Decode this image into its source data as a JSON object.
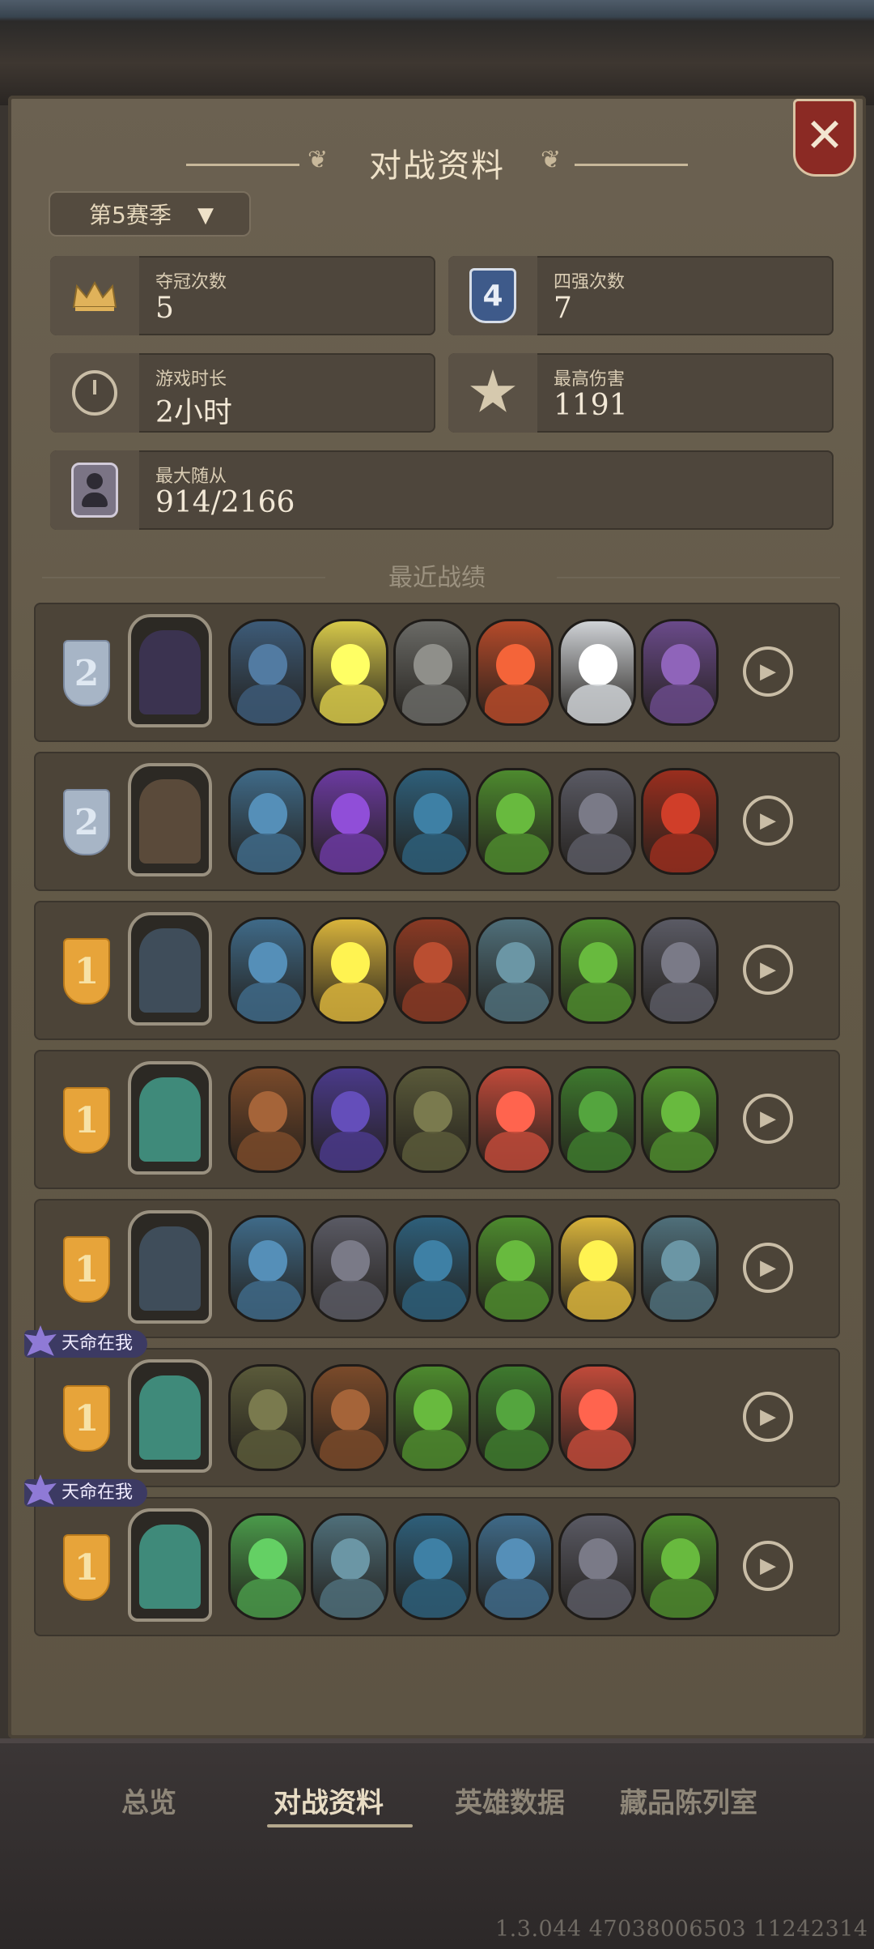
{
  "header": {
    "title": "对战资料",
    "close_label": "✕"
  },
  "season": {
    "label": "第5赛季"
  },
  "stats": {
    "champion": {
      "label": "夺冠次数",
      "value": "5"
    },
    "top4": {
      "label": "四强次数",
      "value": "7",
      "icon_text": "4"
    },
    "playtime": {
      "label": "游戏时长",
      "value": "2小时"
    },
    "max_damage": {
      "label": "最高伤害",
      "value": "1191"
    },
    "max_minion": {
      "label": "最大随从",
      "value": "914/2166"
    }
  },
  "recent": {
    "title": "最近战绩",
    "matches": [
      {
        "rank": "2",
        "rank_color": "silver",
        "tag": "",
        "hero_color": "#3b3350",
        "minions": [
          "#3d5b78",
          "#d7c94a",
          "#6a6a66",
          "#b54a2a",
          "#cfd2d6",
          "#6a4a8a"
        ]
      },
      {
        "rank": "2",
        "rank_color": "silver",
        "tag": "",
        "hero_color": "#5a4a3a",
        "minions": [
          "#3f6a88",
          "#6b3aa0",
          "#2e5f7a",
          "#4d8a2e",
          "#5a5a64",
          "#9a2e1e"
        ]
      },
      {
        "rank": "1",
        "rank_color": "gold",
        "tag": "",
        "hero_color": "#3f4d5a",
        "minions": [
          "#3f6a88",
          "#d9b43c",
          "#8a3a24",
          "#4f6f7a",
          "#4d8a2e",
          "#5a5a64"
        ]
      },
      {
        "rank": "1",
        "rank_color": "gold",
        "tag": "",
        "hero_color": "#3f8a7a",
        "minions": [
          "#7a4a2a",
          "#4a3a8a",
          "#5a5a3a",
          "#c04a3a",
          "#3e7a2e",
          "#4d8a2e"
        ]
      },
      {
        "rank": "1",
        "rank_color": "gold",
        "tag": "",
        "hero_color": "#3f4d5a",
        "minions": [
          "#3f6a88",
          "#5a5a64",
          "#2e5f7a",
          "#4d8a2e",
          "#d9b43c",
          "#4f6f7a"
        ]
      },
      {
        "rank": "1",
        "rank_color": "gold",
        "tag": "天命在我",
        "hero_color": "#3f8a7a",
        "minions": [
          "#5a5a3a",
          "#7a4a2a",
          "#4d8a2e",
          "#3e7a2e",
          "#c04a3a"
        ]
      },
      {
        "rank": "1",
        "rank_color": "gold",
        "tag": "天命在我",
        "hero_color": "#3f8a7a",
        "minions": [
          "#4a9a4a",
          "#4f6f7a",
          "#2e5f7a",
          "#3f6a88",
          "#5a5a64",
          "#4d8a2e"
        ]
      }
    ]
  },
  "tabs": [
    {
      "label": "总览",
      "active": false
    },
    {
      "label": "对战资料",
      "active": true
    },
    {
      "label": "英雄数据",
      "active": false
    },
    {
      "label": "藏品陈列室",
      "active": false
    }
  ],
  "footer": {
    "version": "1.3.044 47038006503 11242314"
  },
  "colors": {
    "accent": "#e8dcc4",
    "panel": "#625947",
    "close": "#8b2a24",
    "gold_rank": "#e7a43a",
    "silver_rank": "#a7b5c6"
  }
}
